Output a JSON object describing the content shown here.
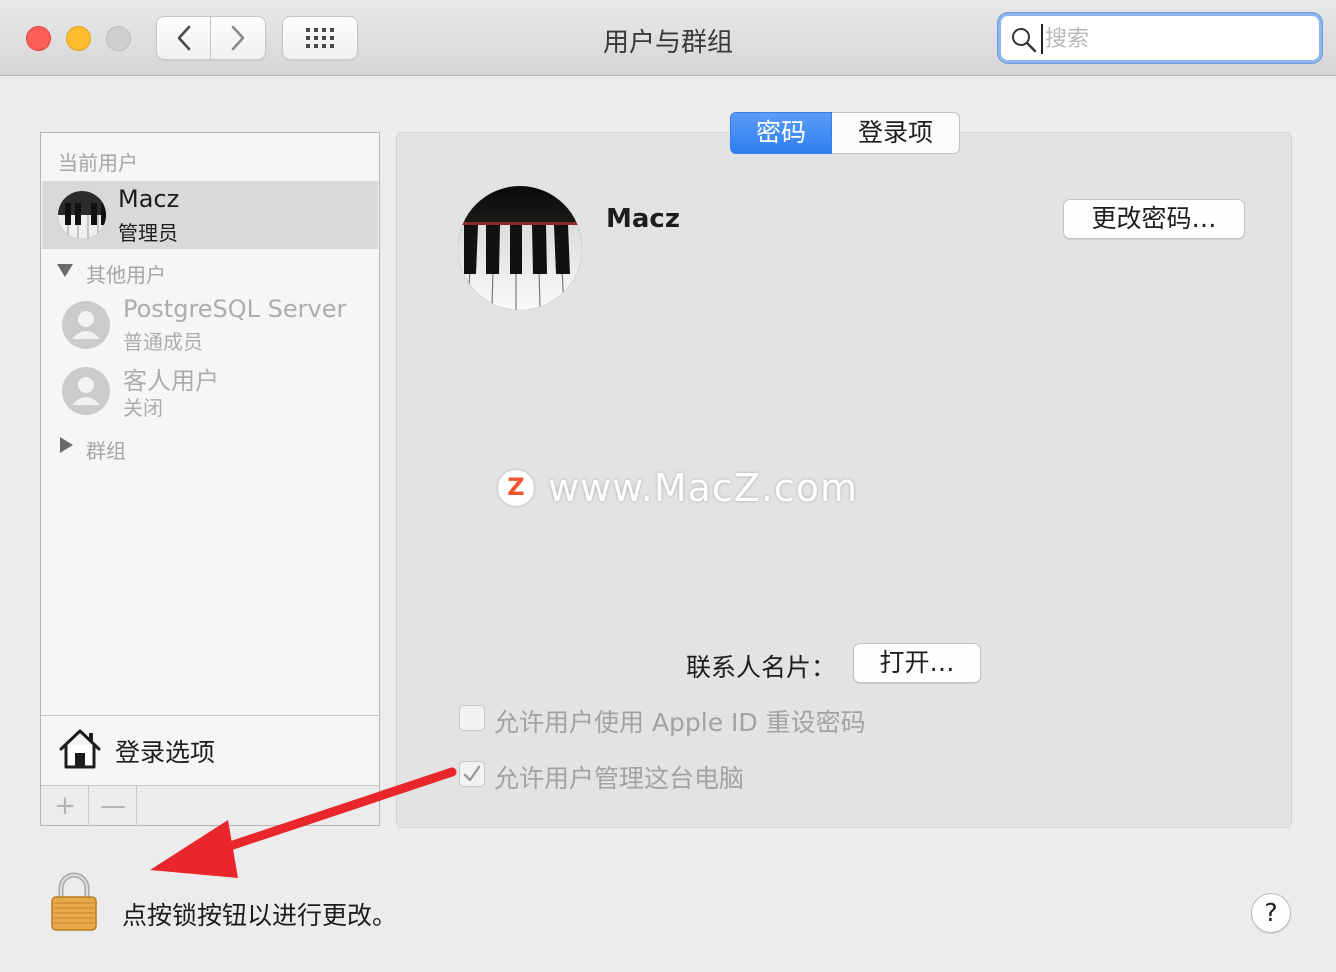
{
  "window": {
    "title": "用户与群组",
    "search_placeholder": "搜索"
  },
  "sidebar": {
    "current_users_label": "当前用户",
    "current_user": {
      "name": "Macz",
      "role": "管理员"
    },
    "other_users_label": "其他用户",
    "other_users": [
      {
        "name": "PostgreSQL Server",
        "role": "普通成员"
      },
      {
        "name": "客人用户",
        "role": "关闭"
      }
    ],
    "groups_label": "群组",
    "login_options_label": "登录选项",
    "add_symbol": "+",
    "remove_symbol": "—"
  },
  "tabs": [
    {
      "label": "密码",
      "active": true
    },
    {
      "label": "登录项",
      "active": false
    }
  ],
  "main": {
    "user_name": "Macz",
    "change_password_label": "更改密码…",
    "contact_card_label": "联系人名片：",
    "open_label": "打开…",
    "checkbox_reset_label": "允许用户使用 Apple ID 重设密码",
    "checkbox_reset_checked": false,
    "checkbox_admin_label": "允许用户管理这台电脑",
    "checkbox_admin_checked": true
  },
  "watermark": {
    "logo_letter": "Z",
    "text": "www.MacZ.com"
  },
  "footer": {
    "lock_text": "点按锁按钮以进行更改。",
    "help_label": "?"
  },
  "colors": {
    "accent_blue": "#2f7ff0",
    "arrow_red": "#e8262b",
    "close": "#fe5f57",
    "minimize": "#febc2e"
  }
}
